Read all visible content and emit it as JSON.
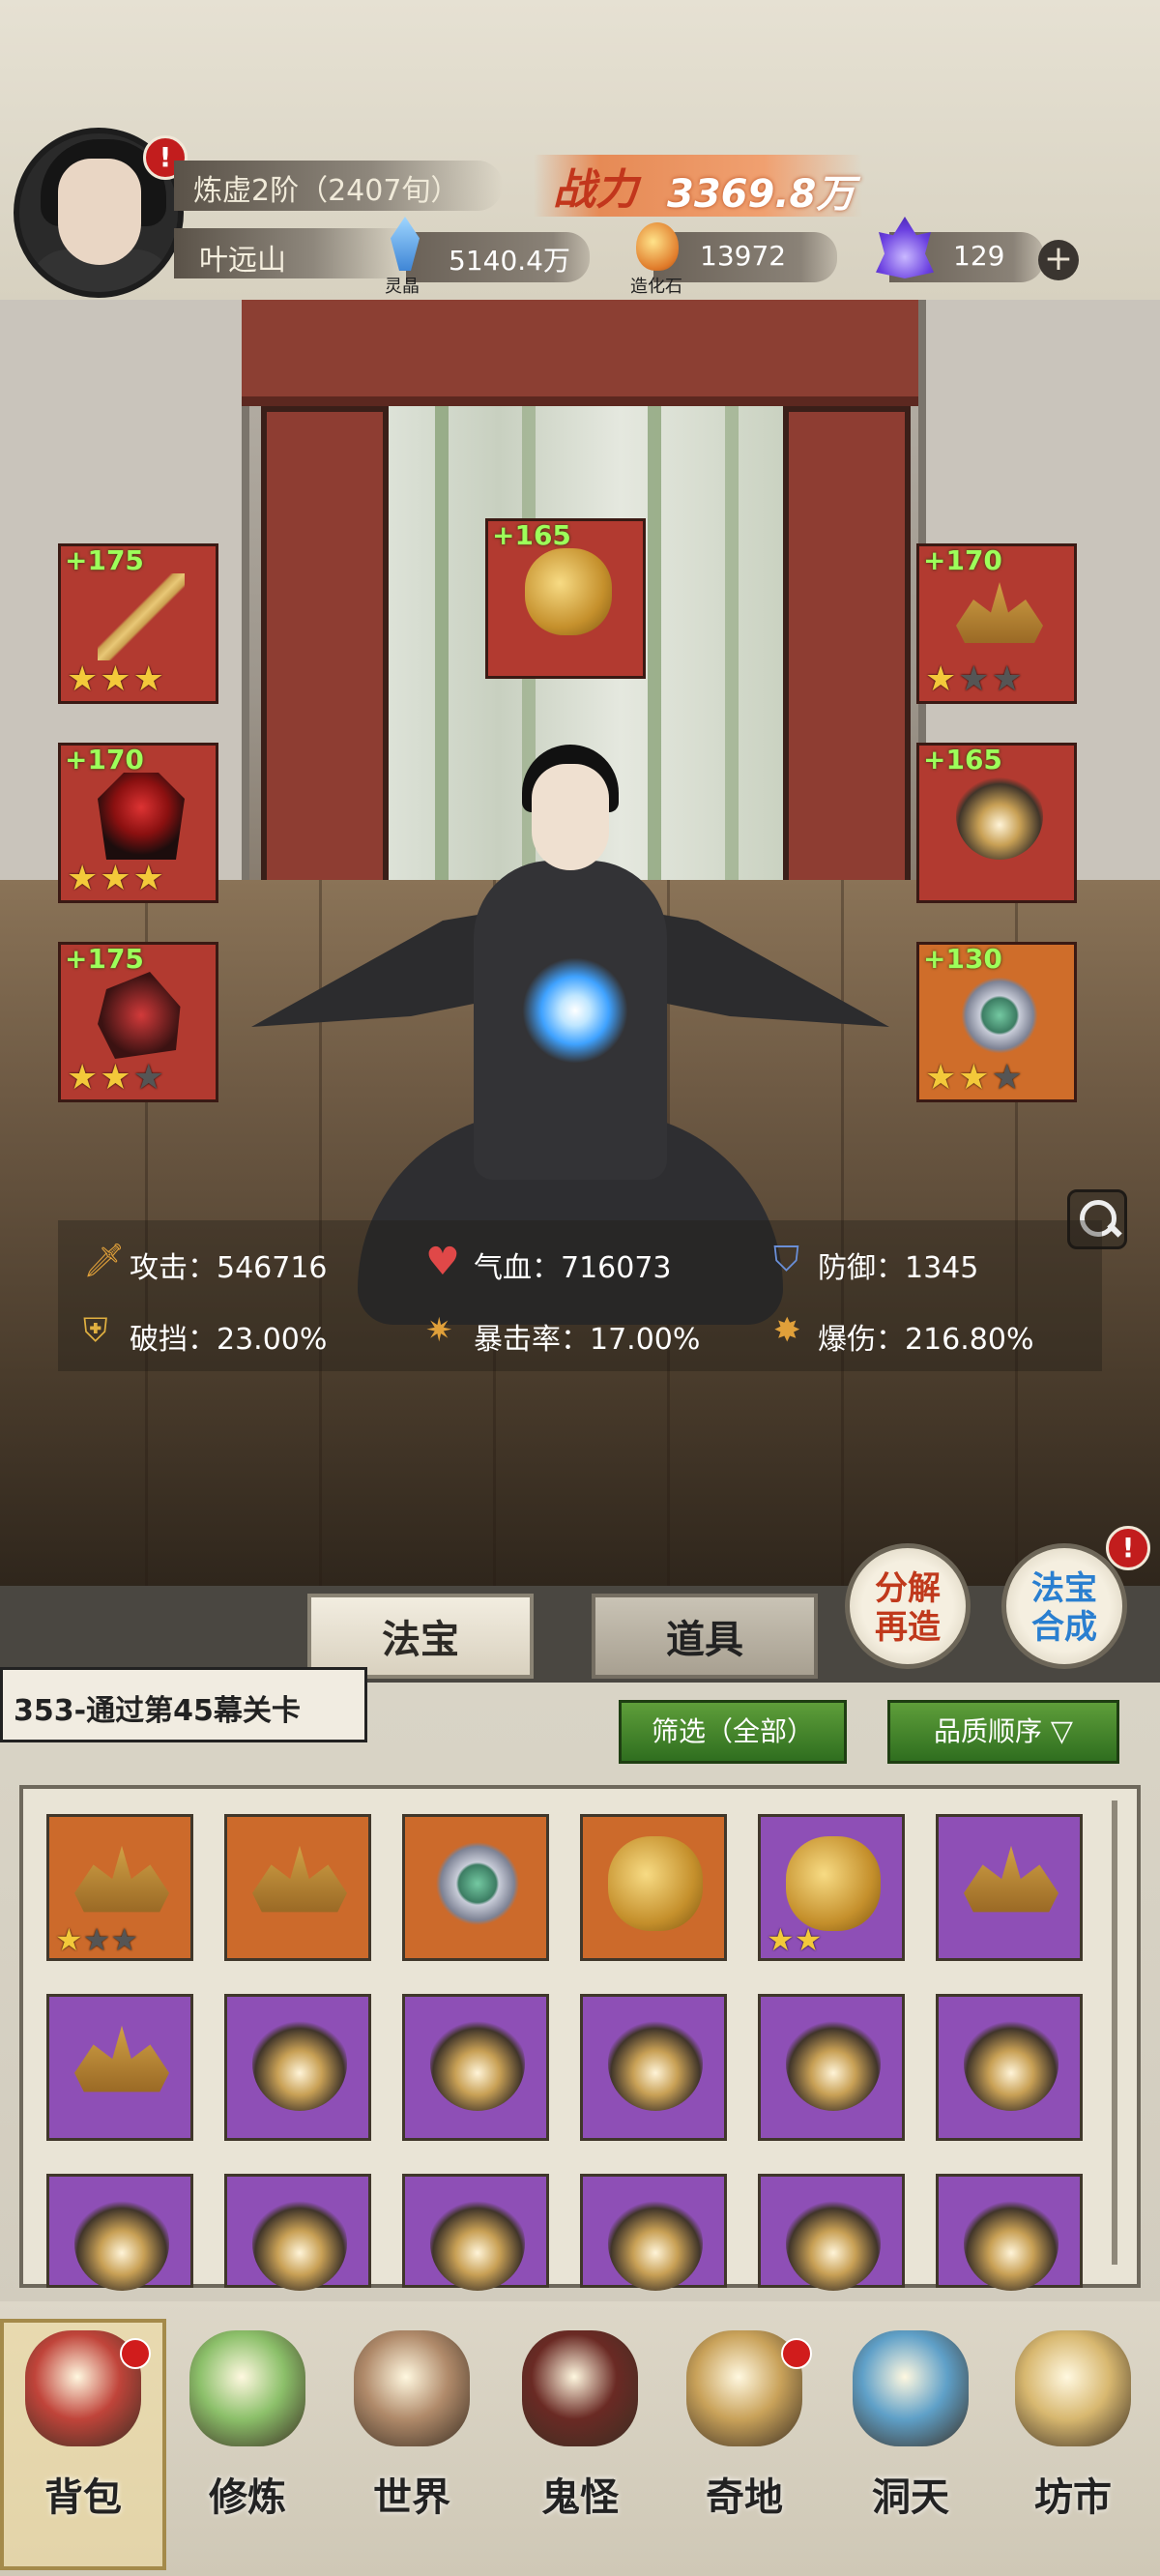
{
  "player": {
    "realm": "炼虚2阶（2407旬）",
    "name": "叶远山",
    "power_label": "战力",
    "power_value": "3369.8万"
  },
  "resources": [
    {
      "name": "灵晶",
      "value": "5140.4万",
      "icon": "crystal-icon"
    },
    {
      "name": "造化石",
      "value": "13972",
      "icon": "stone-icon"
    },
    {
      "name": "",
      "value": "129",
      "icon": "flame-icon"
    }
  ],
  "equipment": {
    "left": [
      {
        "level": "+175",
        "icon": "sword-icon",
        "stars": 3
      },
      {
        "level": "+170",
        "icon": "armor-icon",
        "stars": 3
      },
      {
        "level": "+175",
        "icon": "boots-icon",
        "stars": 2
      }
    ],
    "top": {
      "level": "+165",
      "icon": "dragon-icon",
      "stars": 0
    },
    "right": [
      {
        "level": "+170",
        "icon": "crown-icon",
        "stars": 1
      },
      {
        "level": "+165",
        "icon": "amulet-icon",
        "stars": 0
      },
      {
        "level": "+130",
        "icon": "ring-icon",
        "stars": 2
      }
    ]
  },
  "stats": [
    {
      "label": "攻击：546716",
      "icon": "sword-stat-icon",
      "color": "#e0a03a"
    },
    {
      "label": "气血：716073",
      "icon": "heart-icon",
      "color": "#e04848"
    },
    {
      "label": "防御：1345",
      "icon": "shield-icon",
      "color": "#6a8fd8"
    },
    {
      "label": "破挡：23.00%",
      "icon": "shield-break-icon",
      "color": "#e0b040"
    },
    {
      "label": "暴击率：17.00%",
      "icon": "crit-icon",
      "color": "#e0a03a"
    },
    {
      "label": "爆伤：216.80%",
      "icon": "crit-damage-icon",
      "color": "#e0a03a"
    }
  ],
  "tabs": {
    "fabao": "法宝",
    "daoju": "道具"
  },
  "buttons": {
    "decompose_line1": "分解",
    "decompose_line2": "再造",
    "synth_line1": "法宝",
    "synth_line2": "合成",
    "filter": "筛选（全部）",
    "sort": "品质顺序"
  },
  "stage": "353-通过第45幕关卡",
  "inventory": [
    {
      "quality": "orange",
      "icon": "crown-icon",
      "stars": 1
    },
    {
      "quality": "orange",
      "icon": "crown-icon",
      "stars": 0
    },
    {
      "quality": "orange",
      "icon": "ring-icon",
      "stars": 0
    },
    {
      "quality": "orange",
      "icon": "dragon-icon",
      "stars": 0
    },
    {
      "quality": "purple",
      "icon": "dragon-icon",
      "stars": 2
    },
    {
      "quality": "purple",
      "icon": "crown-icon",
      "stars": 0
    },
    {
      "quality": "purple",
      "icon": "crown-icon",
      "stars": 0
    },
    {
      "quality": "purple",
      "icon": "amulet-icon",
      "stars": 0
    },
    {
      "quality": "purple",
      "icon": "amulet-icon",
      "stars": 0
    },
    {
      "quality": "purple",
      "icon": "amulet-icon",
      "stars": 0
    },
    {
      "quality": "purple",
      "icon": "amulet-icon",
      "stars": 0
    },
    {
      "quality": "purple",
      "icon": "amulet-icon",
      "stars": 0
    },
    {
      "quality": "purple",
      "icon": "amulet-icon",
      "stars": 0
    },
    {
      "quality": "purple",
      "icon": "amulet-icon",
      "stars": 0
    },
    {
      "quality": "purple",
      "icon": "amulet-icon",
      "stars": 0
    },
    {
      "quality": "purple",
      "icon": "amulet-icon",
      "stars": 0
    },
    {
      "quality": "purple",
      "icon": "amulet-icon",
      "stars": 0
    },
    {
      "quality": "purple",
      "icon": "amulet-icon",
      "stars": 0
    }
  ],
  "nav": [
    {
      "label": "背包",
      "icon": "backpack-icon",
      "color": "#c0443a",
      "dot": true
    },
    {
      "label": "修炼",
      "icon": "lotus-icon",
      "color": "#8cc06a",
      "dot": false
    },
    {
      "label": "世界",
      "icon": "scroll-icon",
      "color": "#b08a6a",
      "dot": false
    },
    {
      "label": "鬼怪",
      "icon": "demon-egg-icon",
      "color": "#6a2a24",
      "dot": false
    },
    {
      "label": "奇地",
      "icon": "mountain-icon",
      "color": "#c9a25a",
      "dot": true
    },
    {
      "label": "洞天",
      "icon": "portal-icon",
      "color": "#5fa0c8",
      "dot": false
    },
    {
      "label": "坊市",
      "icon": "market-icon",
      "color": "#d8b870",
      "dot": false
    }
  ]
}
